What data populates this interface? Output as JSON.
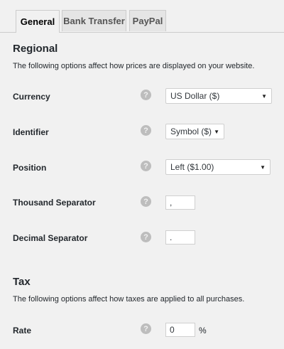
{
  "tabs": [
    "General",
    "Bank Transfer",
    "PayPal"
  ],
  "regional": {
    "title": "Regional",
    "description": "The following options affect how prices are displayed on your website.",
    "currency": {
      "label": "Currency",
      "value": "US Dollar ($)"
    },
    "identifier": {
      "label": "Identifier",
      "value": "Symbol ($)"
    },
    "position": {
      "label": "Position",
      "value": "Left ($1.00)"
    },
    "thousand_separator": {
      "label": "Thousand Separator",
      "value": ","
    },
    "decimal_separator": {
      "label": "Decimal Separator",
      "value": "."
    }
  },
  "tax": {
    "title": "Tax",
    "description": "The following options affect how taxes are applied to all purchases.",
    "rate": {
      "label": "Rate",
      "value": "0",
      "unit": "%"
    }
  },
  "help_glyph": "?",
  "dropdown_glyph": "▼"
}
